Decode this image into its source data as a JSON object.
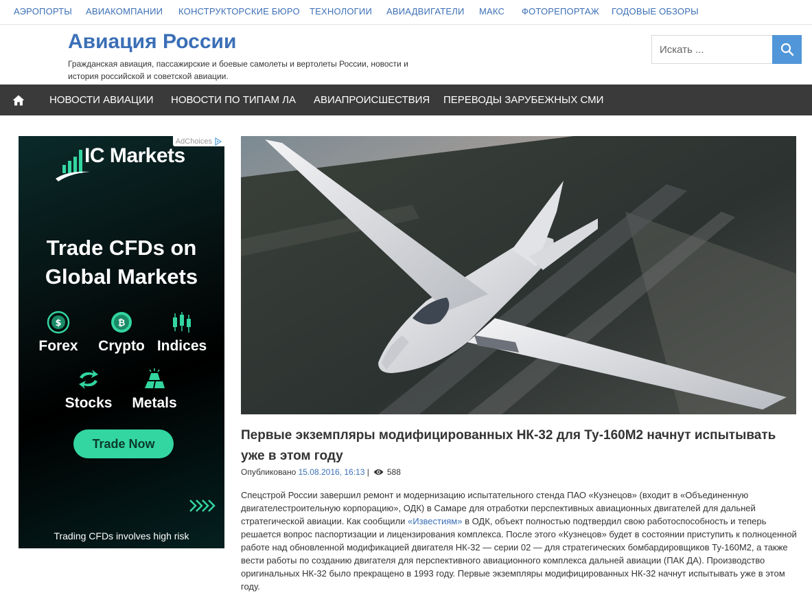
{
  "top_nav": {
    "items": [
      "АЭРОПОРТЫ",
      "АВИАКОМПАНИИ",
      "КОНСТРУКТОРСКИЕ БЮРО",
      "ТЕХНОЛОГИИ",
      "АВИАДВИГАТЕЛИ",
      "МАКС",
      "ФОТОРЕПОРТАЖ",
      "ГОДОВЫЕ ОБЗОРЫ"
    ]
  },
  "header": {
    "title": "Авиация России",
    "description": "Гражданская авиация, пассажирские и боевые самолеты и вертолеты России, новости и история российской и советской авиации."
  },
  "search": {
    "placeholder": "Искать ..."
  },
  "main_nav": {
    "items": [
      "НОВОСТИ АВИАЦИИ",
      "НОВОСТИ ПО ТИПАМ ЛА",
      "АВИАПРОИСШЕСТВИЯ",
      "ПЕРЕВОДЫ ЗАРУБЕЖНЫХ СМИ"
    ]
  },
  "ad": {
    "adchoices": "AdChoices",
    "brand": "IC Markets",
    "headline": "Trade CFDs on Global Markets",
    "categories": [
      "Forex",
      "Crypto",
      "Indices",
      "Stocks",
      "Metals"
    ],
    "cta": "Trade Now",
    "disclaimer": "Trading CFDs involves high risk",
    "colors": {
      "accent": "#33d6a0",
      "background": "#061212"
    }
  },
  "article": {
    "title": "Первые экземпляры модифицированных НК-32 для Ту-160М2 начнут испытывать уже в этом году",
    "published_label": "Опубликовано",
    "date": "15.08.2016, 16:13",
    "separator": "|",
    "views": "588",
    "body_part1": "Спецстрой России завершил ремонт и модернизацию испытательного стенда ПАО «Кузнецов» (входит в «Объединенную двигателестроительную корпорацию», ОДК) в Самаре для отработки перспективных авиационных двигателей для дальней стратегической авиации. Как сообщили ",
    "body_link": "«Известиям»",
    "body_part2": " в ОДК, объект полностью подтвердил свою работоспособность и теперь решается вопрос паспортизации и лицензирования комплекса. После этого «Кузнецов» будет в состоянии приступить к полноценной работе над обновленной модификацией двигателя НК-32 — серии 02 — для стратегических бомбардировщиков Ту-160М2, а также вести работы по созданию двигателя для перспективного авиационного комплекса дальней авиации (ПАК ДА). Производство оригинальных НК-32 было прекращено в 1993 году. Первые экземпляры модифицированных НК-32 начнут испытывать уже в этом году."
  },
  "colors": {
    "link": "#3b6fb6",
    "nav_bg": "#3a3a3a",
    "search_button": "#5196d8"
  }
}
